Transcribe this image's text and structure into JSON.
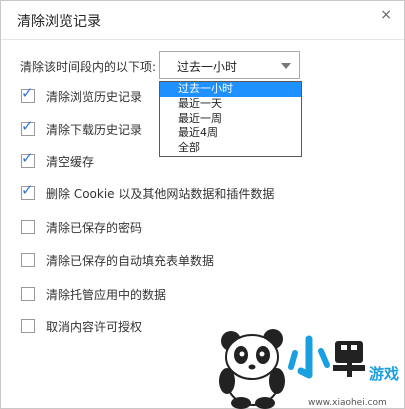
{
  "dialog": {
    "title": "清除浏览记录",
    "close_symbol": "×"
  },
  "range": {
    "label": "清除该时间段内的以下项:",
    "selected": "过去一小时",
    "options": [
      "过去一小时",
      "最近一天",
      "最近一周",
      "最近4周",
      "全部"
    ]
  },
  "items": [
    {
      "label": "清除浏览历史记录",
      "checked": true
    },
    {
      "label": "清除下载历史记录",
      "checked": true
    },
    {
      "label": "清空缓存",
      "checked": true
    },
    {
      "label": "删除 Cookie 以及其他网站数据和插件数据",
      "checked": true
    },
    {
      "label": "清除已保存的密码",
      "checked": false
    },
    {
      "label": "清除已保存的自动填充表单数据",
      "checked": false
    },
    {
      "label": "清除托管应用中的数据",
      "checked": false
    },
    {
      "label": "取消内容许可授权",
      "checked": false
    }
  ],
  "watermark": {
    "brand": "小黑游戏",
    "url": "www.xiaohei.com"
  },
  "colors": {
    "check": "#3277d8",
    "selection": "#1e90ff"
  }
}
